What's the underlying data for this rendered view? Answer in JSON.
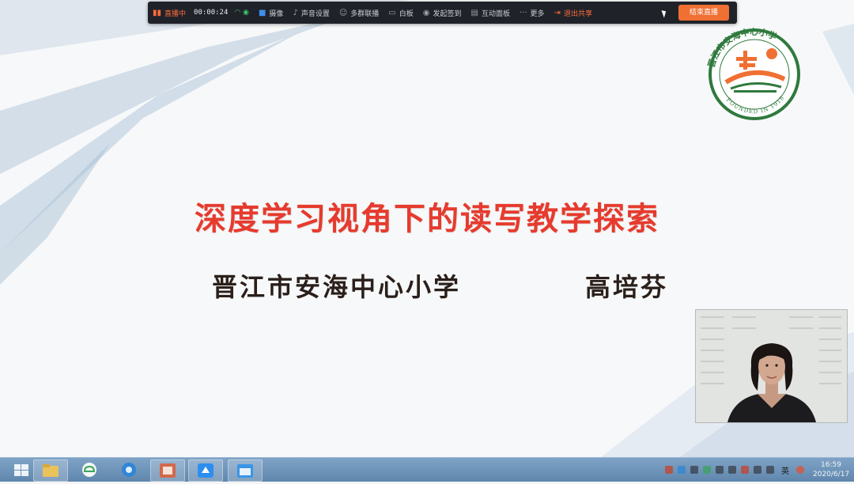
{
  "toolbar": {
    "status_label": "直播中",
    "timer": "00:00:24",
    "items": {
      "camera": "摄像",
      "audio": "声音设置",
      "multi_cam": "多群联播",
      "whiteboard": "白板",
      "checkin": "发起签到",
      "interact": "互动面板",
      "more": "更多",
      "exit_share": "退出共享"
    },
    "end_live": "结束直播"
  },
  "slide": {
    "title": "深度学习视角下的读写教学探索",
    "school": "晋江市安海中心小学",
    "author": "高培芬"
  },
  "logo": {
    "ring_text": "晋江市安海中心小学",
    "founded": "FOUNDED IN 1918"
  },
  "taskbar": {
    "ime": "英",
    "time": "16:59",
    "date": "2020/6/17"
  },
  "colors": {
    "title_red": "#e63b2e",
    "accent_orange": "#f07033",
    "logo_green": "#2f7a3d"
  }
}
